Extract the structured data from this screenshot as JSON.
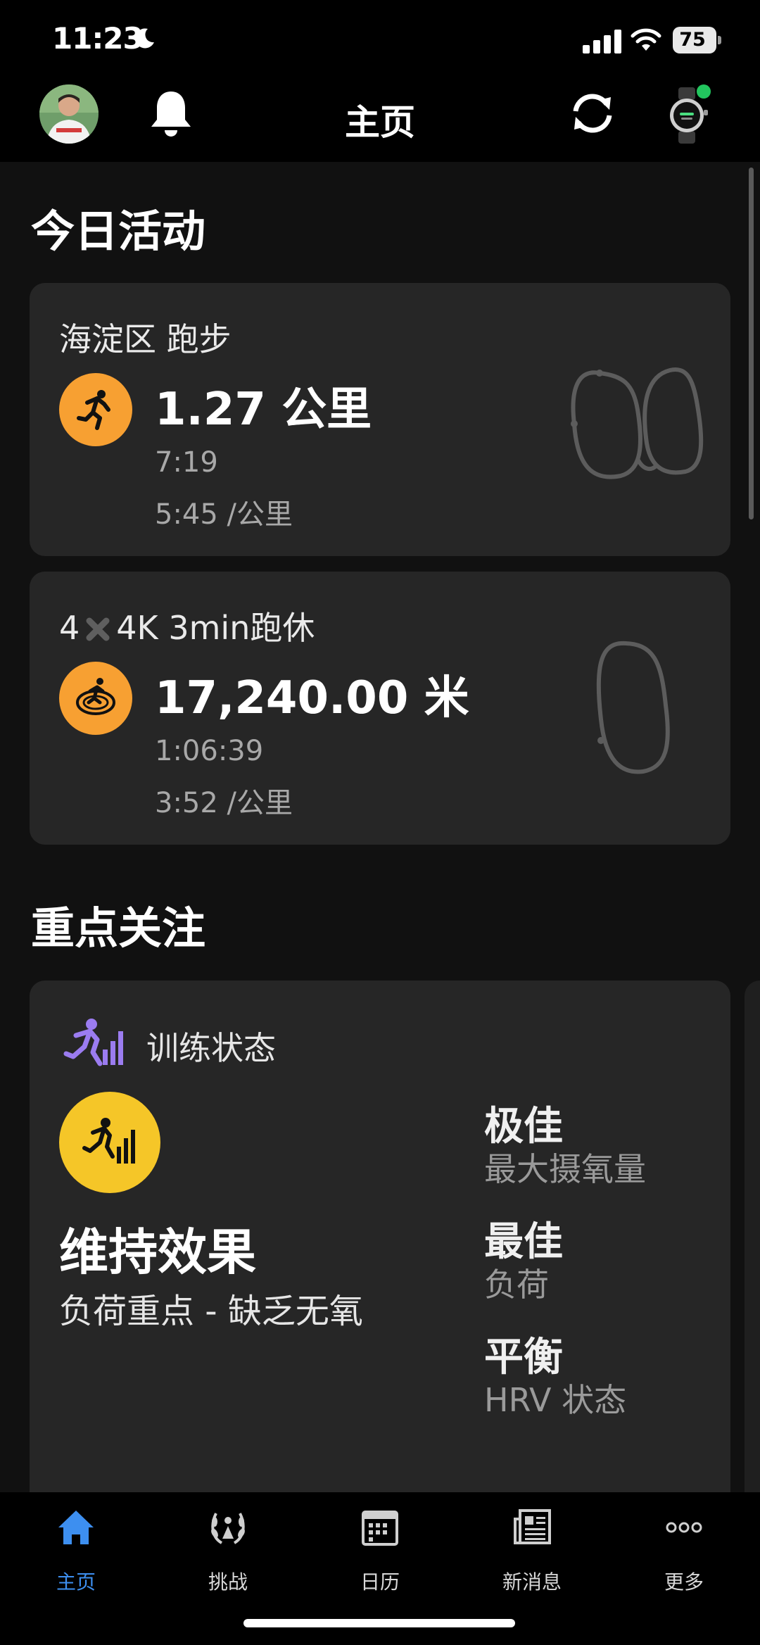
{
  "status_bar": {
    "time": "11:23",
    "battery": "75",
    "icons": [
      "moon-icon",
      "signal-icon",
      "wifi-icon",
      "battery-icon"
    ]
  },
  "header": {
    "title": "主页",
    "icons": [
      "avatar",
      "bell-icon",
      "sync-icon",
      "watch-icon"
    ]
  },
  "today": {
    "section_title": "今日活动",
    "activities": [
      {
        "title": "海淀区 跑步",
        "distance": "1.27 公里",
        "duration": "7:19",
        "pace": "5:45 /公里",
        "icon": "running-icon"
      },
      {
        "title_prefix": "4",
        "title_suffix": "4K 3min跑休",
        "distance": "17,240.00 米",
        "duration": "1:06:39",
        "pace": "3:52 /公里",
        "icon": "track-running-icon"
      }
    ]
  },
  "focus": {
    "section_title": "重点关注",
    "card": {
      "label": "训练状态",
      "status": "维持效果",
      "sub": "负荷重点 - 缺乏无氧",
      "metrics": [
        {
          "value": "极佳",
          "label": "最大摄氧量"
        },
        {
          "value": "最佳",
          "label": "负荷"
        },
        {
          "value": "平衡",
          "label": "HRV 状态"
        }
      ]
    }
  },
  "nav": {
    "items": [
      {
        "label": "主页",
        "icon": "home-icon",
        "active": true
      },
      {
        "label": "挑战",
        "icon": "laurel-icon",
        "active": false
      },
      {
        "label": "日历",
        "icon": "calendar-icon",
        "active": false
      },
      {
        "label": "新消息",
        "icon": "news-icon",
        "active": false
      },
      {
        "label": "更多",
        "icon": "more-icon",
        "active": false
      }
    ]
  },
  "colors": {
    "activity_orange": "#f7a032",
    "status_yellow": "#f5c628",
    "active_blue": "#3d8ff0",
    "accent_purple": "#9b7cf0",
    "watch_dot": "#22c55e"
  }
}
